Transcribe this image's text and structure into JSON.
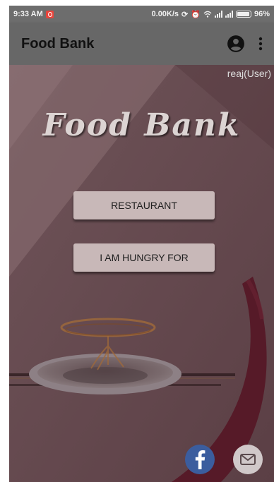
{
  "statusbar": {
    "time": "9:33 AM",
    "network_speed": "0.00K/s",
    "battery_text": "96%",
    "notification_icon": "app-notification-icon",
    "icons": [
      "sync-icon",
      "alarm-icon",
      "wifi-icon",
      "signal-icon",
      "signal-icon",
      "battery-icon"
    ]
  },
  "appbar": {
    "title": "Food Bank",
    "account_icon": "account-circle-icon",
    "menu_icon": "more-vert-icon"
  },
  "main": {
    "user_label": "reaj(User)",
    "logo_text": "Food Bank",
    "buttons": {
      "restaurant": "RESTAURANT",
      "hungry": "I AM HUNGRY FOR"
    },
    "social": {
      "facebook_icon": "facebook-icon",
      "mail_icon": "mail-icon"
    }
  },
  "colors": {
    "appbar": "#676767",
    "statusbar": "#6d6d6d",
    "background_dark": "#5a3c42",
    "background_light": "#6e5257",
    "button": "#c8b8b8",
    "facebook": "#3b5d9e",
    "crimson_swoosh": "#5c1c2b"
  }
}
